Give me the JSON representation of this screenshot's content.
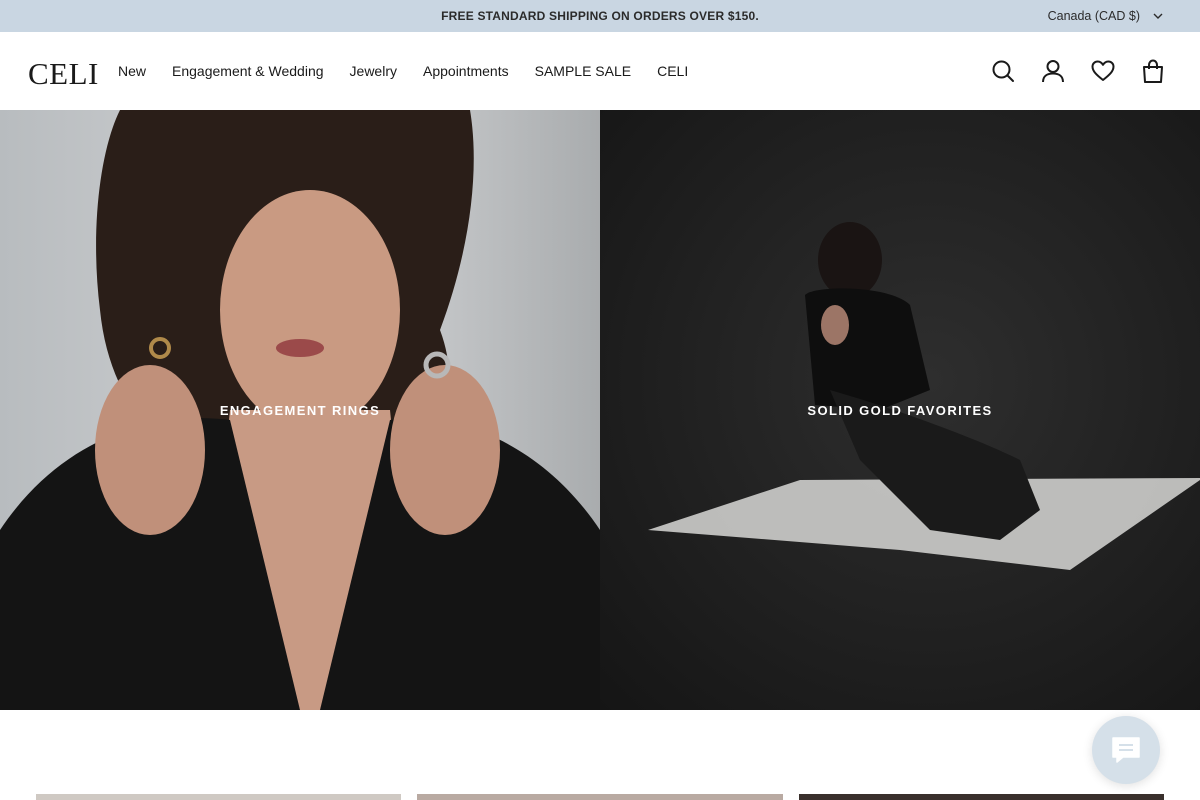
{
  "announcement": {
    "text": "FREE STANDARD SHIPPING ON ORDERS OVER $150."
  },
  "country_selector": {
    "label": "Canada (CAD $)",
    "icon": "chevron-down-icon"
  },
  "header": {
    "logo": "CELI",
    "nav": [
      {
        "label": "New"
      },
      {
        "label": "Engagement & Wedding"
      },
      {
        "label": "Jewelry"
      },
      {
        "label": "Appointments"
      },
      {
        "label": "SAMPLE SALE"
      },
      {
        "label": "CELI"
      }
    ],
    "icons": [
      "search-icon",
      "account-icon",
      "wishlist-heart-icon",
      "cart-bag-icon"
    ]
  },
  "hero": {
    "tiles": [
      {
        "label": "ENGAGEMENT RINGS"
      },
      {
        "label": "SOLID GOLD FAVORITES"
      }
    ]
  },
  "chat": {
    "icon": "chat-bubble-icon",
    "accent": "#d5e0e9"
  },
  "colors": {
    "announcement_bg": "#c9d6e2",
    "text": "#1a1a1a",
    "tile_label": "#ffffff"
  }
}
